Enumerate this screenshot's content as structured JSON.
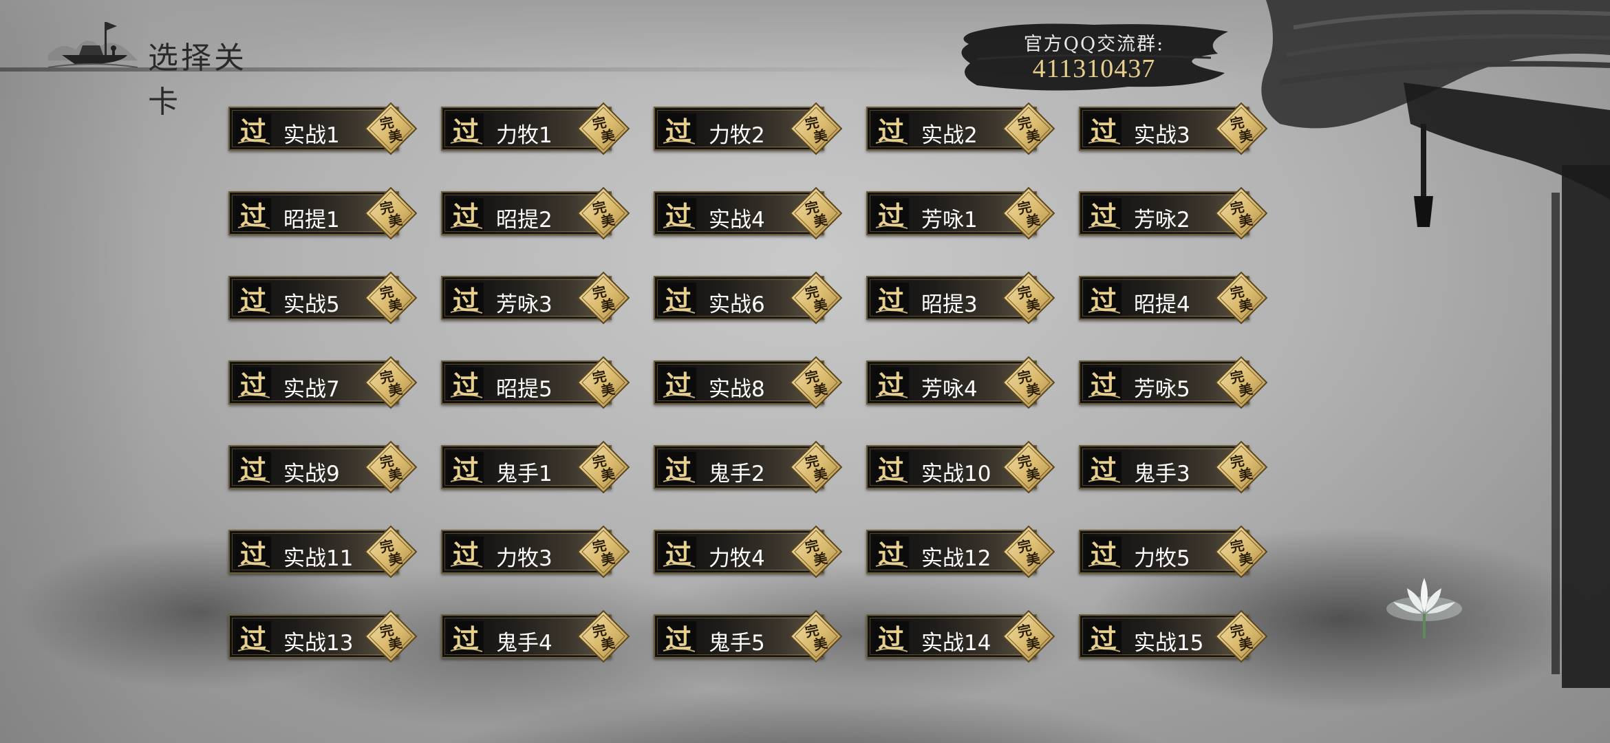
{
  "header": {
    "title": "选择关卡",
    "back_icon": "boat-icon"
  },
  "qq_group": {
    "label": "官方QQ交流群:",
    "number": "411310437"
  },
  "badges": {
    "pass_glyph": "过",
    "perfect_glyph": "完美"
  },
  "colors": {
    "gold": "#e7cf8e",
    "card_dark": "#0d0d0d",
    "card_light": "#5e5545"
  },
  "levels": [
    {
      "name": "实战1"
    },
    {
      "name": "力牧1"
    },
    {
      "name": "力牧2"
    },
    {
      "name": "实战2"
    },
    {
      "name": "实战3"
    },
    {
      "name": "昭提1"
    },
    {
      "name": "昭提2"
    },
    {
      "name": "实战4"
    },
    {
      "name": "芳咏1"
    },
    {
      "name": "芳咏2"
    },
    {
      "name": "实战5"
    },
    {
      "name": "芳咏3"
    },
    {
      "name": "实战6"
    },
    {
      "name": "昭提3"
    },
    {
      "name": "昭提4"
    },
    {
      "name": "实战7"
    },
    {
      "name": "昭提5"
    },
    {
      "name": "实战8"
    },
    {
      "name": "芳咏4"
    },
    {
      "name": "芳咏5"
    },
    {
      "name": "实战9"
    },
    {
      "name": "鬼手1"
    },
    {
      "name": "鬼手2"
    },
    {
      "name": "实战10"
    },
    {
      "name": "鬼手3"
    },
    {
      "name": "实战11"
    },
    {
      "name": "力牧3"
    },
    {
      "name": "力牧4"
    },
    {
      "name": "实战12"
    },
    {
      "name": "力牧5"
    },
    {
      "name": "实战13"
    },
    {
      "name": "鬼手4"
    },
    {
      "name": "鬼手5"
    },
    {
      "name": "实战14"
    },
    {
      "name": "实战15"
    }
  ]
}
